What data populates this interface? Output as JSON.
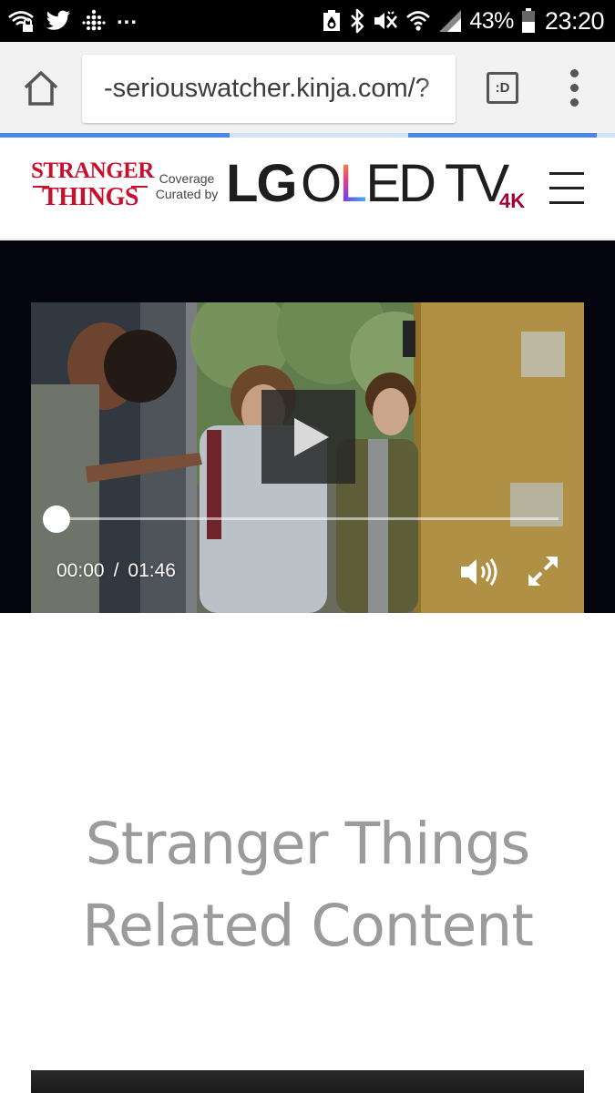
{
  "status_bar": {
    "left_overflow": "...",
    "battery": "43%",
    "time": "23:20"
  },
  "browser": {
    "url": "-seriouswatcher.kinja.com/?",
    "tabs_count": ":D"
  },
  "header": {
    "show_logo_line1": "STRANGER",
    "show_logo_line2": "THINGS",
    "curated_line1": "Coverage",
    "curated_line2": "Curated by",
    "brand_lg": "LG",
    "brand_oled_o": "O",
    "brand_oled_l": "L",
    "brand_oled_rest": "ED TV",
    "brand_4k": "4K",
    "brand_color": "#a50034",
    "show_color": "#c8102e"
  },
  "video": {
    "current_time": "00:00",
    "separator": "/",
    "duration": "01:46",
    "progress": 0
  },
  "related": {
    "title_line1": "Stranger Things",
    "title_line2": "Related Content"
  },
  "icons": [
    "wifi-lock-icon",
    "twitter-icon",
    "fitbit-icon",
    "recycle-icon",
    "bluetooth-icon",
    "mute-icon",
    "wifi-icon",
    "signal-icon",
    "battery-icon",
    "home-icon",
    "tabs-icon",
    "overflow-menu-icon",
    "hamburger-menu-icon",
    "play-icon",
    "volume-icon",
    "fullscreen-icon"
  ]
}
